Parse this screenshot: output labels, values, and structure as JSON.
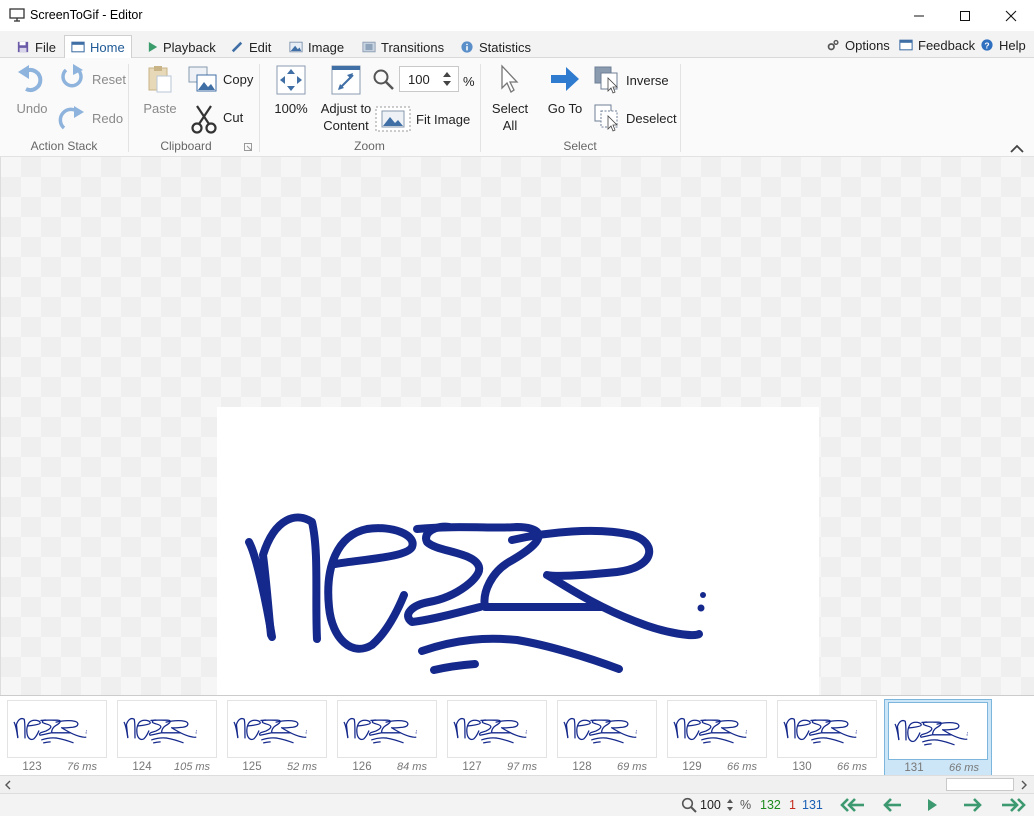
{
  "window": {
    "title": "ScreenToGif - Editor"
  },
  "tabs": [
    {
      "label": "File",
      "icon": "floppy-icon"
    },
    {
      "label": "Home",
      "icon": "home-icon"
    },
    {
      "label": "Playback",
      "icon": "play-icon"
    },
    {
      "label": "Edit",
      "icon": "pencil-icon"
    },
    {
      "label": "Image",
      "icon": "image-icon"
    },
    {
      "label": "Transitions",
      "icon": "transitions-icon"
    },
    {
      "label": "Statistics",
      "icon": "info-icon"
    }
  ],
  "right_links": {
    "options": "Options",
    "feedback": "Feedback",
    "help": "Help"
  },
  "ribbon": {
    "action_stack": {
      "label": "Action Stack",
      "undo": "Undo",
      "reset": "Reset",
      "redo": "Redo"
    },
    "clipboard": {
      "label": "Clipboard",
      "paste": "Paste",
      "copy": "Copy",
      "cut": "Cut"
    },
    "zoom": {
      "label": "Zoom",
      "zoom100": "100%",
      "adjust1": "Adjust to",
      "adjust2": "Content",
      "fit": "Fit Image",
      "value": "100",
      "unit": "%"
    },
    "select": {
      "label": "Select",
      "selectall1": "Select",
      "selectall2": "All",
      "goto": "Go To",
      "inverse": "Inverse",
      "deselect": "Deselect"
    }
  },
  "frames": [
    {
      "num": "123",
      "ms": "76 ms"
    },
    {
      "num": "124",
      "ms": "105 ms"
    },
    {
      "num": "125",
      "ms": "52 ms"
    },
    {
      "num": "126",
      "ms": "84 ms"
    },
    {
      "num": "127",
      "ms": "97 ms"
    },
    {
      "num": "128",
      "ms": "69 ms"
    },
    {
      "num": "129",
      "ms": "66 ms"
    },
    {
      "num": "130",
      "ms": "66 ms"
    },
    {
      "num": "131",
      "ms": "66 ms"
    }
  ],
  "status": {
    "zoom": "100",
    "unit": "%",
    "total": "132",
    "selected": "1",
    "current": "131"
  },
  "colors": {
    "accent": "#1f5a96",
    "ink": "#15298c",
    "total": "#1e8a1e",
    "selected": "#c42b1c",
    "current": "#1a5fb4",
    "nav": "#3d9970"
  }
}
